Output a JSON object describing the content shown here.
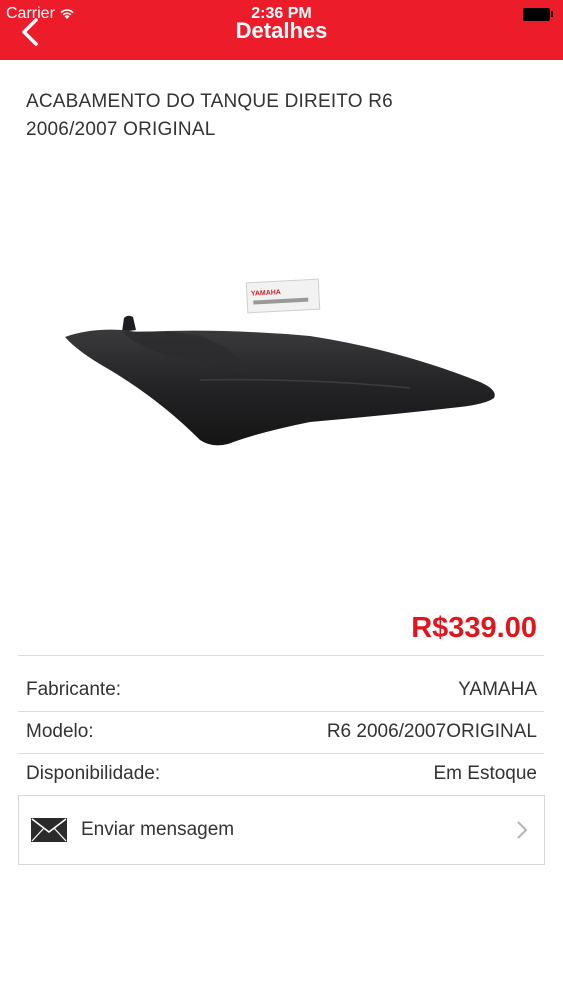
{
  "status_bar": {
    "carrier": "Carrier",
    "time": "2:36 PM"
  },
  "nav": {
    "title": "Detalhes"
  },
  "product": {
    "title": "ACABAMENTO DO TANQUE DIREITO R6 2006/2007 ORIGINAL",
    "price": "R$339.00",
    "label_brand": "YAMAHA"
  },
  "details": [
    {
      "label": "Fabricante:",
      "value": "YAMAHA"
    },
    {
      "label": "Modelo:",
      "value": "R6 2006/2007ORIGINAL"
    },
    {
      "label": "Disponibilidade:",
      "value": "Em Estoque"
    }
  ],
  "message": {
    "label": "Enviar mensagem"
  },
  "colors": {
    "accent": "#ec1c2a",
    "price": "#e0151d"
  }
}
